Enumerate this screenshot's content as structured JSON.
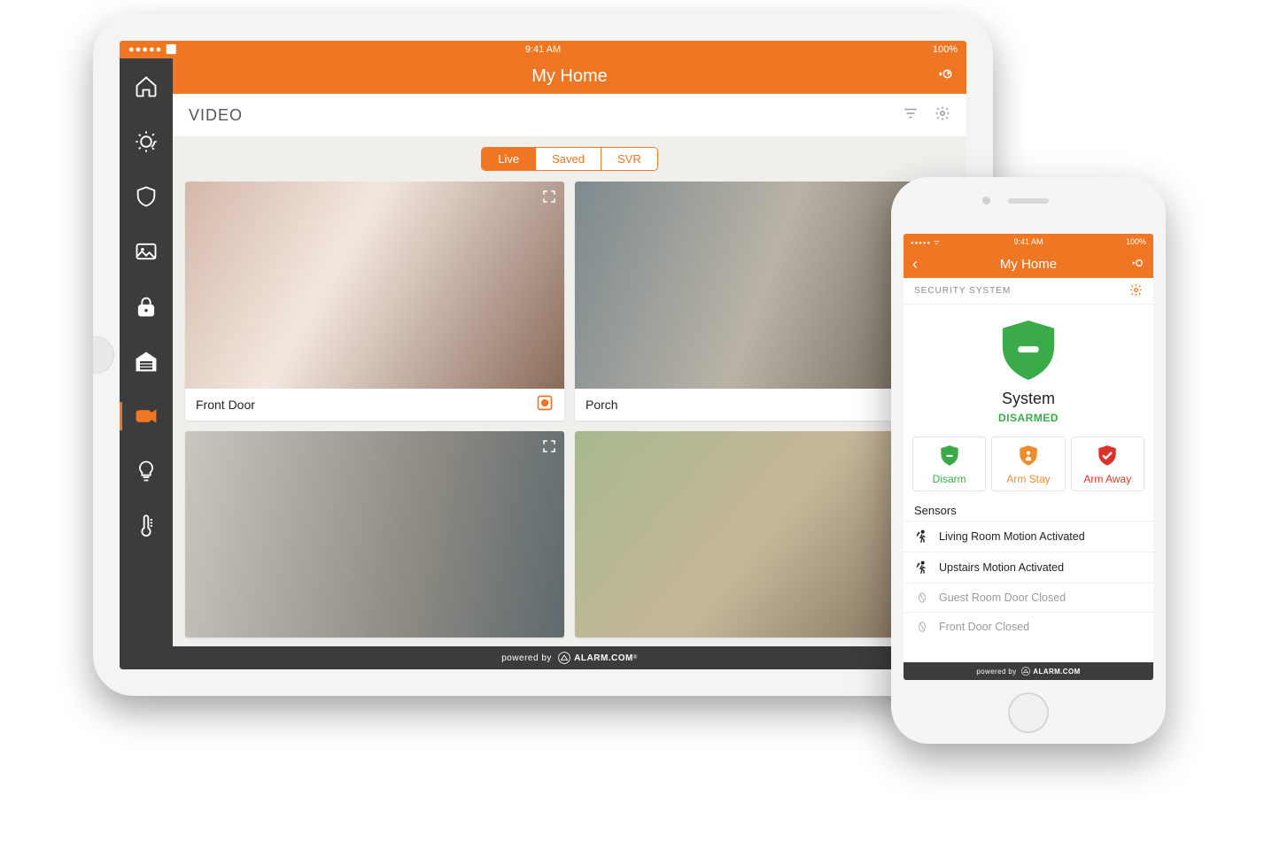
{
  "tablet": {
    "statusbar": {
      "time": "9:41 AM",
      "battery": "100%"
    },
    "title": "My Home",
    "section": "VIDEO",
    "segments": {
      "live": "Live",
      "saved": "Saved",
      "svr": "SVR"
    },
    "cards": {
      "front_door": "Front Door",
      "porch": "Porch"
    },
    "footer_prefix": "powered by",
    "footer_brand": "ALARM.COM"
  },
  "phone": {
    "statusbar": {
      "time": "9:41 AM",
      "battery": "100%"
    },
    "title": "My Home",
    "section": "SECURITY SYSTEM",
    "system_name": "System",
    "system_state": "DISARMED",
    "arm": {
      "disarm": "Disarm",
      "stay": "Arm Stay",
      "away": "Arm Away"
    },
    "sensors_header": "Sensors",
    "sensors": [
      {
        "label": "Living Room Motion Activated",
        "active": true
      },
      {
        "label": "Upstairs Motion Activated",
        "active": true
      },
      {
        "label": "Guest Room Door Closed",
        "active": false
      },
      {
        "label": "Front Door Closed",
        "active": false
      }
    ],
    "footer_prefix": "powered by",
    "footer_brand": "ALARM.COM"
  },
  "colors": {
    "accent": "#ef7622",
    "green": "#3bab4a",
    "red": "#d9342c"
  }
}
